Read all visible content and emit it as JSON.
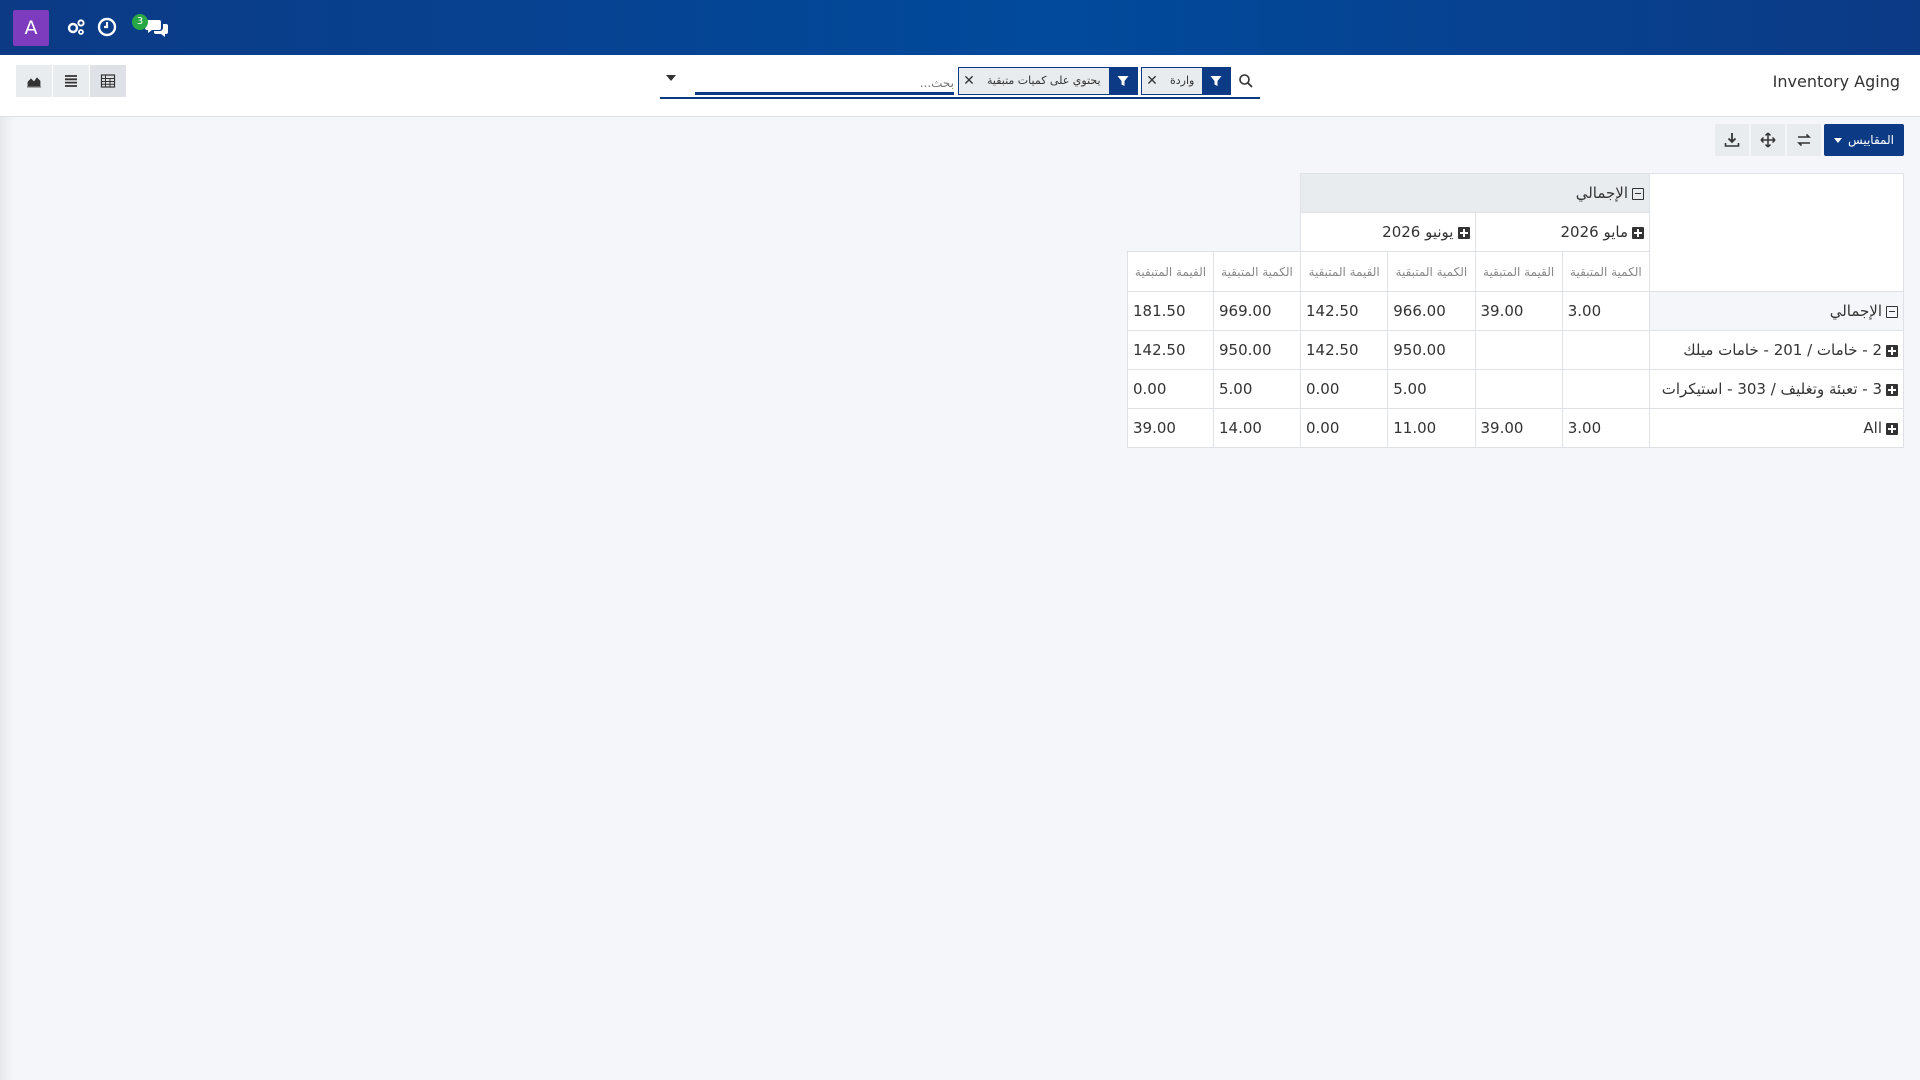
{
  "navbar": {
    "avatar_letter": "A",
    "chat_badge": "3",
    "colors": {
      "bg": "#0c3a85",
      "avatar": "#7d3bbd",
      "badge": "#28a745"
    }
  },
  "control_panel": {
    "title": "Inventory Aging",
    "search": {
      "placeholder": "بحث...",
      "facets": [
        {
          "label": "واردة"
        },
        {
          "label": "يحتوي على كميات متبقية"
        }
      ]
    }
  },
  "toolbar": {
    "measures_label": "المقاييس"
  },
  "pivot": {
    "header_total": "الإجمالي",
    "months": [
      "مايو 2026",
      "يونيو 2026"
    ],
    "measures": [
      "الكمية المتبقية",
      "القيمة المتبقية",
      "الكمية المتبقية",
      "القيمة المتبقية",
      "الكمية المتبقية",
      "القيمة المتبقية"
    ],
    "rows": [
      {
        "label": "الإجمالي",
        "values": [
          "3.00",
          "39.00",
          "966.00",
          "142.50",
          "969.00",
          "181.50"
        ]
      },
      {
        "label": "2 - خامات / 201 - خامات ميلك",
        "values": [
          "",
          "",
          "950.00",
          "142.50",
          "950.00",
          "142.50"
        ]
      },
      {
        "label": "3 - تعبئة وتغليف / 303 - استيكرات",
        "values": [
          "",
          "",
          "5.00",
          "0.00",
          "5.00",
          "0.00"
        ]
      },
      {
        "label": "All",
        "values": [
          "3.00",
          "39.00",
          "11.00",
          "0.00",
          "14.00",
          "39.00"
        ]
      }
    ]
  }
}
